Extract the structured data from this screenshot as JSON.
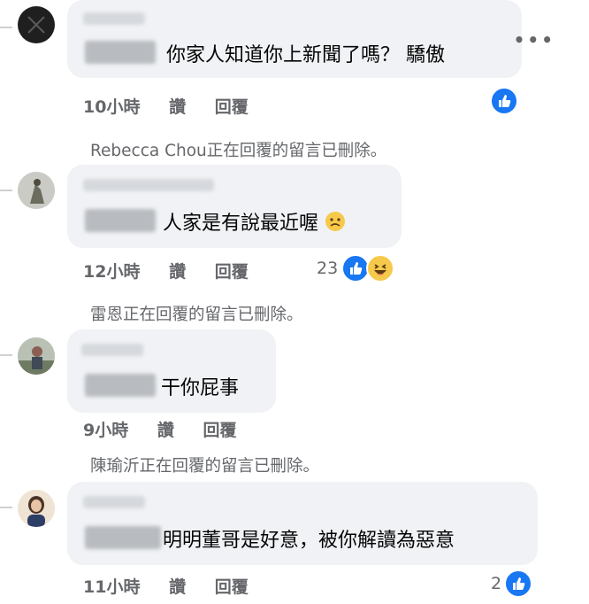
{
  "comments": [
    {
      "text": "你家人知道你上新聞了嗎？ 驕傲",
      "time": "10小時",
      "like": "讚",
      "reply": "回覆"
    },
    {
      "text": "人家是有說最近喔",
      "time": "12小時",
      "like": "讚",
      "reply": "回覆",
      "reaction_count": "23"
    },
    {
      "text": "干你屁事",
      "time": "9小時",
      "like": "讚",
      "reply": "回覆"
    },
    {
      "text": "明明董哥是好意，被你解讀為惡意",
      "time": "11小時",
      "like": "讚",
      "reply": "回覆",
      "reaction_count": "2"
    }
  ],
  "deleted_notices": [
    "Rebecca Chou正在回覆的留言已刪除。",
    "雷恩正在回覆的留言已刪除。",
    "陳瑜沂正在回覆的留言已刪除。"
  ],
  "icons": {
    "more": "more-options-icon",
    "like": "like-reaction-icon",
    "haha": "haha-reaction-icon",
    "worried": "worried-face-emoji"
  },
  "colors": {
    "like_blue": "#1877f2",
    "bubble": "#f0f2f5",
    "meta_gray": "#65676b"
  }
}
